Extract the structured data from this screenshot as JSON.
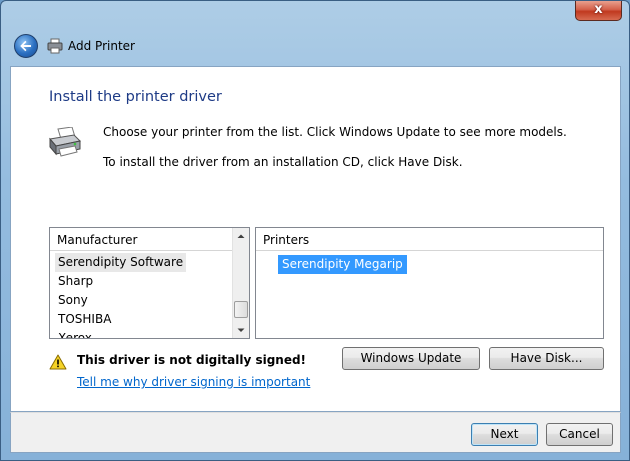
{
  "window": {
    "title": "Add Printer",
    "close_label": "x"
  },
  "page": {
    "heading": "Install the printer driver",
    "instruction1": "Choose your printer from the list. Click Windows Update to see more models.",
    "instruction2": "To install the driver from an installation CD, click Have Disk."
  },
  "manufacturer_list": {
    "header": "Manufacturer",
    "items": [
      "Serendipity Software",
      "Sharp",
      "Sony",
      "TOSHIBA",
      "Xerox"
    ],
    "selected": "Serendipity Software"
  },
  "printer_list": {
    "header": "Printers",
    "items": [
      "Serendipity Megarip"
    ],
    "selected": "Serendipity Megarip"
  },
  "warning": {
    "text": "This driver is not digitally signed!",
    "link": "Tell me why driver signing is important"
  },
  "buttons": {
    "windows_update": "Windows Update",
    "have_disk": "Have Disk...",
    "next": "Next",
    "cancel": "Cancel"
  },
  "icons": {
    "back": "back-arrow-icon",
    "printer": "printer-icon",
    "warning": "warning-icon"
  },
  "colors": {
    "heading": "#1e3b86",
    "selection": "#3399ff",
    "link": "#0066cc"
  }
}
